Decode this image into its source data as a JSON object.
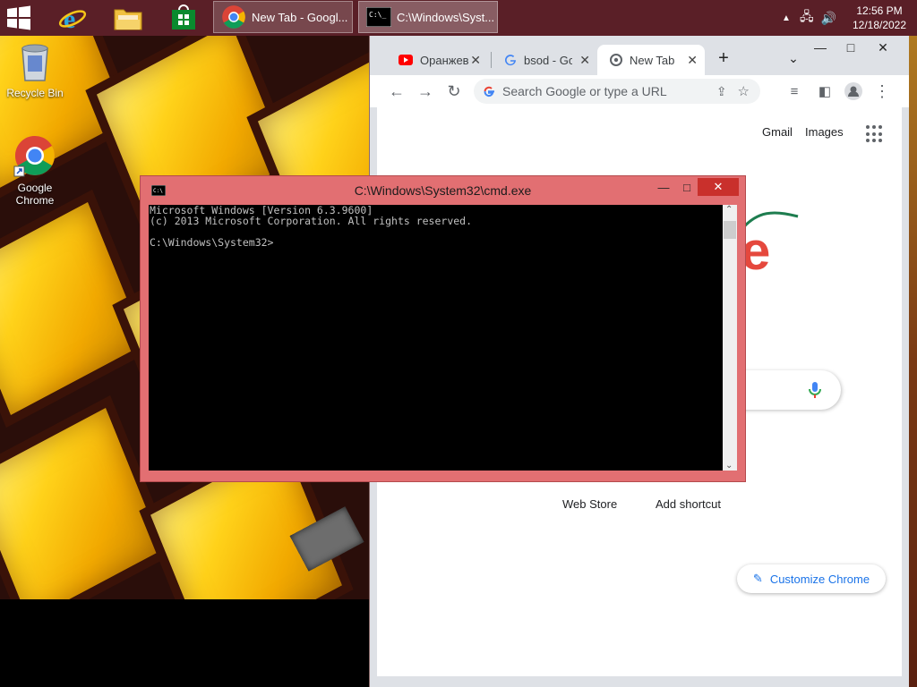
{
  "desktop": {
    "icons": [
      {
        "label": "Recycle Bin",
        "icon": "recycle-bin-icon"
      },
      {
        "label": "Google Chrome",
        "icon": "chrome-icon"
      }
    ]
  },
  "taskbar": {
    "tasks": [
      {
        "label": "New Tab - Googl...",
        "icon": "chrome-icon"
      },
      {
        "label": "C:\\Windows\\Syst...",
        "icon": "cmd-icon"
      }
    ],
    "clock": {
      "time": "12:56 PM",
      "date": "12/18/2022"
    },
    "colors": {
      "background": "#5a1f27"
    }
  },
  "chrome": {
    "tabs": [
      {
        "label": "Оранжев",
        "icon": "youtube-icon"
      },
      {
        "label": "bsod - Goo",
        "icon": "google-g-icon"
      },
      {
        "label": "New Tab",
        "icon": "chrome-icon"
      }
    ],
    "omnibox_placeholder": "Search Google or type a URL",
    "links": {
      "gmail": "Gmail",
      "images": "Images"
    },
    "shortcuts": {
      "web_store": "Web Store",
      "add_shortcut": "Add shortcut"
    },
    "customize": "Customize Chrome",
    "doodle_letter": "e"
  },
  "cmd": {
    "title": "C:\\Windows\\System32\\cmd.exe",
    "lines": [
      "Microsoft Windows [Version 6.3.9600]",
      "(c) 2013 Microsoft Corporation. All rights reserved.",
      "",
      "C:\\Windows\\System32>"
    ],
    "colors": {
      "frame": "#e26f72",
      "close": "#c9302c"
    }
  }
}
